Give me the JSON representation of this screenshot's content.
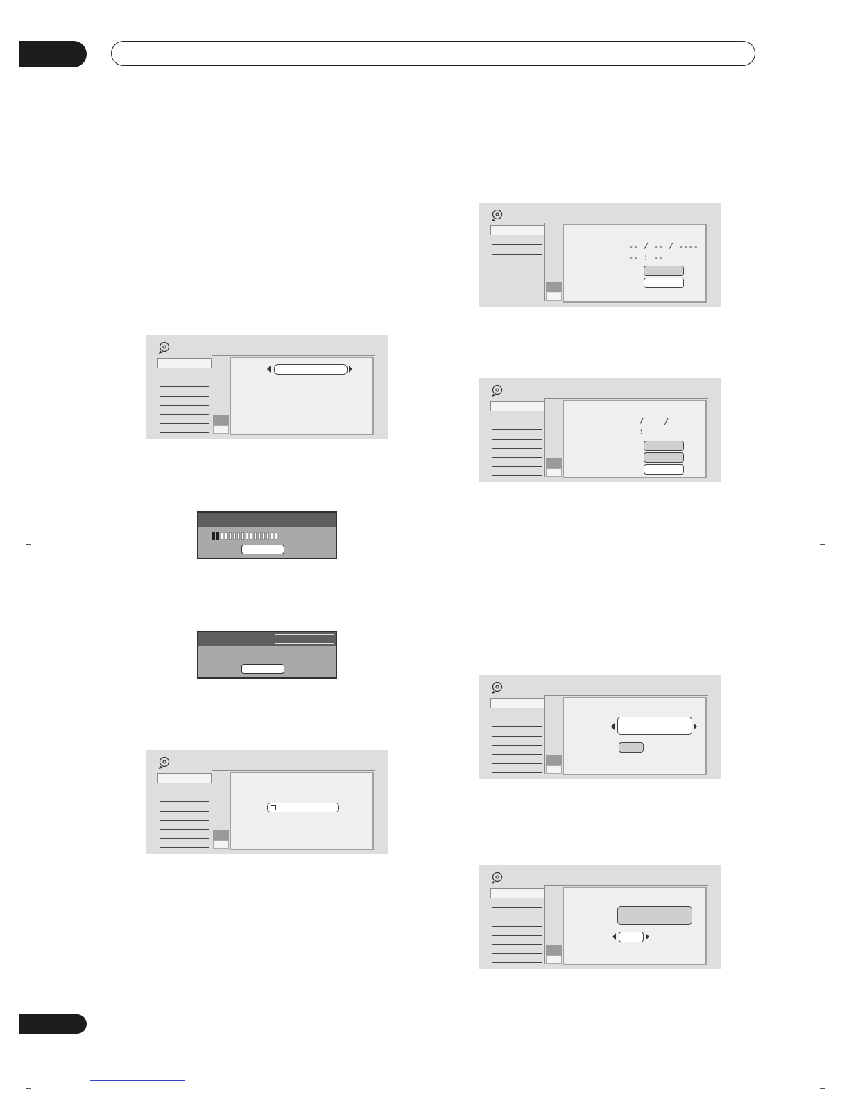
{
  "page": {
    "header_text": "",
    "chapter_label": "",
    "page_number": ""
  },
  "screens": {
    "date_time_blank": {
      "date_text": "-- / -- / ----",
      "time_text": "-- : --"
    },
    "date_time_set": {
      "date_text": "/    /",
      "time_text": ":"
    }
  },
  "dialogs": {
    "progress": {
      "progress_fraction": 0.12,
      "segments_total": 16,
      "segments_on": 2
    }
  },
  "colors": {
    "panel_bg": "#dedede",
    "content_bg": "#efefef",
    "dialog_title": "#5e5e5e",
    "dialog_bg": "#a9a9a9",
    "tab": "#1c1c1c"
  },
  "icons": {
    "screen_icon": "disc-icon"
  }
}
